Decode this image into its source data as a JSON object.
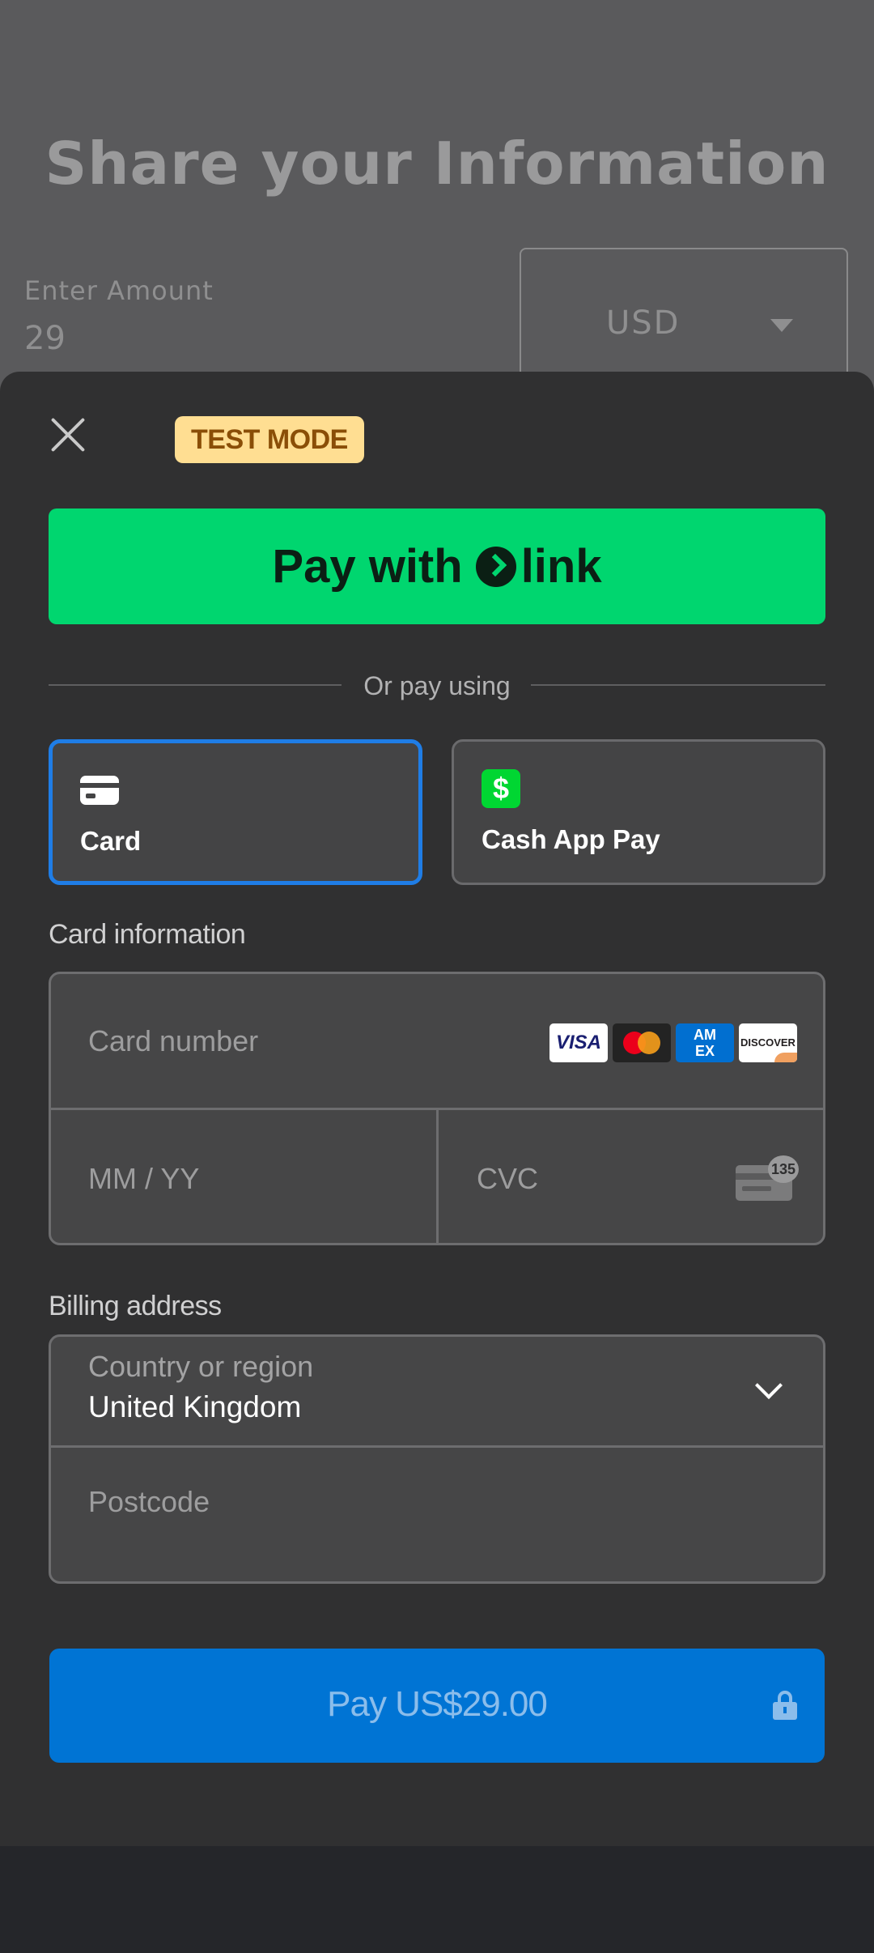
{
  "background_page": {
    "title": "Share your Information",
    "amount_label": "Enter Amount",
    "amount_value": "29",
    "currency_value": "USD"
  },
  "sheet": {
    "test_mode_badge": "TEST MODE",
    "link_button": {
      "prefix": "Pay with",
      "brand": "link"
    },
    "divider_text": "Or pay using",
    "payment_methods": [
      {
        "label": "Card",
        "icon": "card-icon",
        "selected": true
      },
      {
        "label": "Cash App Pay",
        "icon": "cash-app-icon",
        "selected": false
      }
    ],
    "card_info": {
      "section_label": "Card information",
      "card_number_placeholder": "Card number",
      "expiry_placeholder": "MM / YY",
      "cvc_placeholder": "CVC",
      "brands": [
        "VISA",
        "Mastercard",
        "AMEX",
        "DISCOVER"
      ],
      "cvc_hint_number": "135"
    },
    "billing": {
      "section_label": "Billing address",
      "country_label": "Country or region",
      "country_value": "United Kingdom",
      "postcode_placeholder": "Postcode"
    },
    "pay_button": {
      "label": "Pay US$29.00",
      "icon": "lock-icon"
    }
  },
  "colors": {
    "link_green": "#00d66f",
    "selected_border": "#1f7de6",
    "pay_blue": "#0074d4",
    "badge_bg": "#ffde92"
  }
}
